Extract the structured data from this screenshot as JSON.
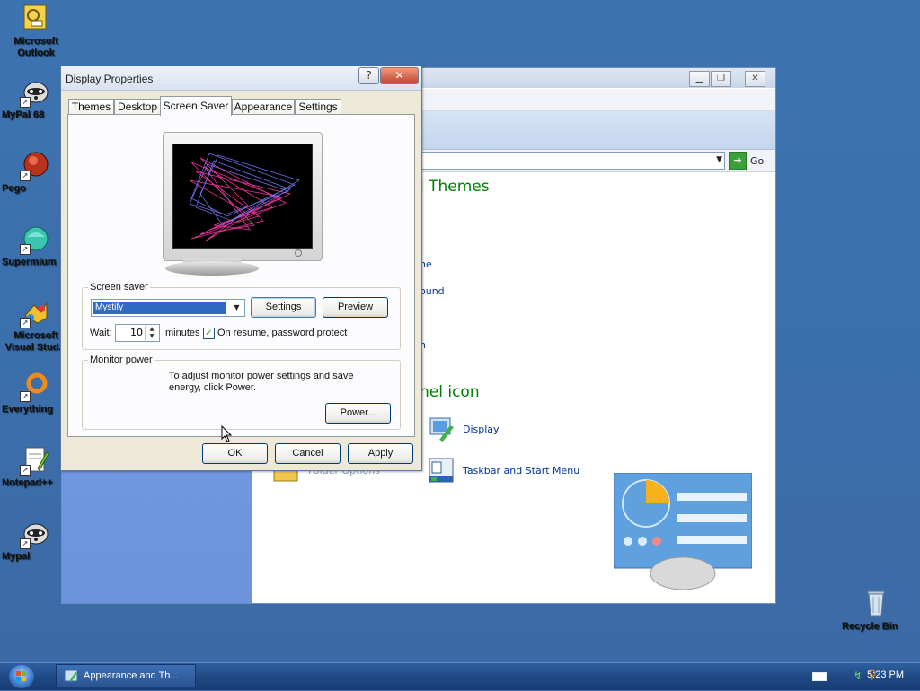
{
  "desktop": {
    "icons": [
      {
        "label": "Microsoft Outlook"
      },
      {
        "label": "MyPal 68"
      },
      {
        "label": "Pego"
      },
      {
        "label": "Supermium"
      },
      {
        "label": "Microsoft Visual Stud..."
      },
      {
        "label": "Everything"
      },
      {
        "label": "Notepad++"
      },
      {
        "label": "Mypal"
      },
      {
        "label": "Recycle Bin"
      }
    ]
  },
  "control_panel": {
    "go_label": "Go",
    "heading_themes": "l Themes",
    "heading_icon": "nel icon",
    "links": [
      "ne",
      "ound",
      "n"
    ],
    "items": {
      "display": "Display",
      "taskbar": "Taskbar and Start Menu",
      "folder_options": "Folder Options"
    }
  },
  "dialog": {
    "title": "Display Properties",
    "help_glyph": "?",
    "close_glyph": "✕",
    "tabs": [
      "Themes",
      "Desktop",
      "Screen Saver",
      "Appearance",
      "Settings"
    ],
    "active_tab": "Screen Saver",
    "screen_saver": {
      "group_label": "Screen saver",
      "selected": "Mystify",
      "settings_label": "Settings",
      "preview_label": "Preview",
      "wait_label": "Wait:",
      "wait_value": "10",
      "minutes_label": "minutes",
      "password_protect_label": "On resume, password protect",
      "password_protect_checked": true
    },
    "monitor_power": {
      "group_label": "Monitor power",
      "description": "To adjust monitor power settings and save energy, click Power.",
      "power_label": "Power..."
    },
    "ok_label": "OK",
    "cancel_label": "Cancel",
    "apply_label": "Apply"
  },
  "taskbar": {
    "task_label": "Appearance and Th...",
    "clock": "5:23 PM"
  }
}
